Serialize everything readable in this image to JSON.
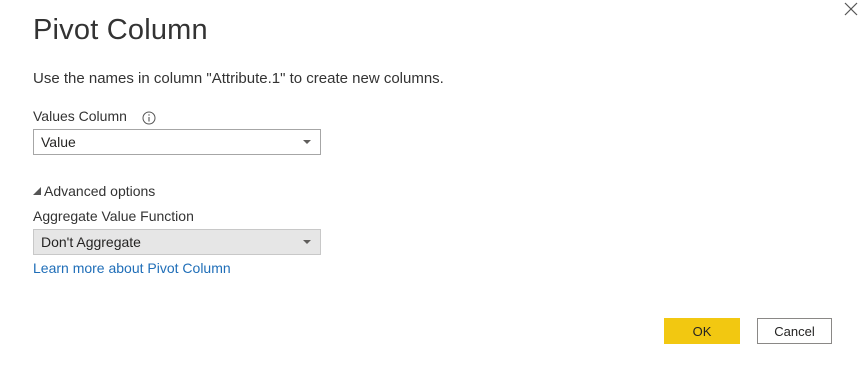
{
  "dialog": {
    "title": "Pivot Column",
    "description": "Use the names in column \"Attribute.1\" to create new columns.",
    "close_icon": "close-icon"
  },
  "values_column": {
    "label": "Values Column",
    "info_icon": "info-icon",
    "selected": "Value"
  },
  "advanced": {
    "label": "Advanced options",
    "expanded": true,
    "aggregate_label": "Aggregate Value Function",
    "aggregate_selected": "Don't Aggregate"
  },
  "learn_more": "Learn more about Pivot Column",
  "buttons": {
    "ok": "OK",
    "cancel": "Cancel"
  },
  "colors": {
    "accent": "#f2c811",
    "link": "#1f6eb8",
    "disabled_field": "#e6e6e6"
  }
}
